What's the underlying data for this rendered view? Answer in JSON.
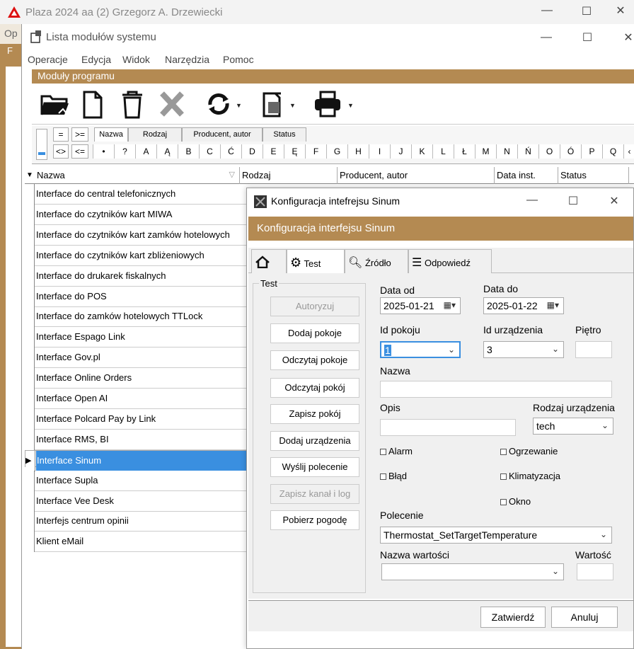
{
  "outer": {
    "title": "Plaza 2024 aa (2) Grzegorz A. Drzewiecki",
    "left_fragment": "Op",
    "left_tab": "F"
  },
  "module_window": {
    "title": "Lista modułów systemu",
    "menu": [
      "Operacje",
      "Edycja",
      "Widok",
      "Narzędzia",
      "Pomoc"
    ],
    "band": "Moduły programu",
    "toolbar_icons": [
      "open-folder-icon",
      "new-document-icon",
      "trash-icon",
      "delete-x-icon",
      "refresh-icon",
      "export-icon",
      "print-icon"
    ],
    "filter": {
      "ops": [
        "=",
        ">=",
        "<>",
        "<="
      ],
      "tabs": [
        "Nazwa",
        "Rodzaj",
        "Producent, autor",
        "Status"
      ],
      "letters": [
        "•",
        "?",
        "A",
        "Ą",
        "B",
        "C",
        "Ć",
        "D",
        "E",
        "Ę",
        "F",
        "G",
        "H",
        "I",
        "J",
        "K",
        "L",
        "Ł",
        "M",
        "N",
        "Ń",
        "O",
        "Ó",
        "P",
        "Q"
      ]
    },
    "columns": [
      "Nazwa",
      "Rodzaj",
      "Producent, autor",
      "Data inst.",
      "Status"
    ],
    "rows": [
      "Interface do central telefonicznych",
      "Interface do czytników kart MIWA",
      "Interface do czytników kart zamków hotelowych",
      "Interface do czytników kart zbliżeniowych",
      "Interface do drukarek fiskalnych",
      "Interface do POS",
      "Interface do zamków hotelowych TTLock",
      "Interface Espago Link",
      "Interface Gov.pl",
      "Interface Online Orders",
      "Interface Open AI",
      "Interface Polcard Pay by Link",
      "Interface RMS, BI",
      "Interface Sinum",
      "Interface Supla",
      "Interface Vee Desk",
      "Interfejs centrum opinii",
      "Klient eMail"
    ],
    "selected_row": "Interface Sinum"
  },
  "dialog": {
    "title": "Konfiguracja intefrejsu Sinum",
    "band": "Konfiguracja interfejsu Sinum",
    "tabs": {
      "home": "",
      "test": "Test",
      "source": "Źródło",
      "response": "Odpowiedź"
    },
    "group_label": "Test",
    "buttons": {
      "authorize": "Autoryzuj",
      "add_rooms": "Dodaj pokoje",
      "read_rooms": "Odczytaj pokoje",
      "read_room": "Odczytaj pokój",
      "save_room": "Zapisz pokój",
      "add_devices": "Dodaj urządzenia",
      "send_command": "Wyślij polecenie",
      "save_channel": "Zapisz kanał i log",
      "get_weather": "Pobierz pogodę"
    },
    "fields": {
      "date_from_label": "Data od",
      "date_from": "2025-01-21",
      "date_to_label": "Data do",
      "date_to": "2025-01-22",
      "room_id_label": "Id pokoju",
      "room_id": "1",
      "device_id_label": "Id urządzenia",
      "device_id": "3",
      "floor_label": "Piętro",
      "floor": "",
      "name_label": "Nazwa",
      "name": "",
      "desc_label": "Opis",
      "desc": "",
      "device_type_label": "Rodzaj urządzenia",
      "device_type": "tech",
      "command_label": "Polecenie",
      "command": "Thermostat_SetTargetTemperature",
      "value_name_label": "Nazwa wartości",
      "value_name": "",
      "value_label": "Wartość",
      "value": ""
    },
    "checkboxes": {
      "alarm": "Alarm",
      "error": "Błąd",
      "heating": "Ogrzewanie",
      "ac": "Klimatyzacja",
      "window": "Okno"
    },
    "footer": {
      "ok": "Zatwierdź",
      "cancel": "Anuluj"
    }
  }
}
